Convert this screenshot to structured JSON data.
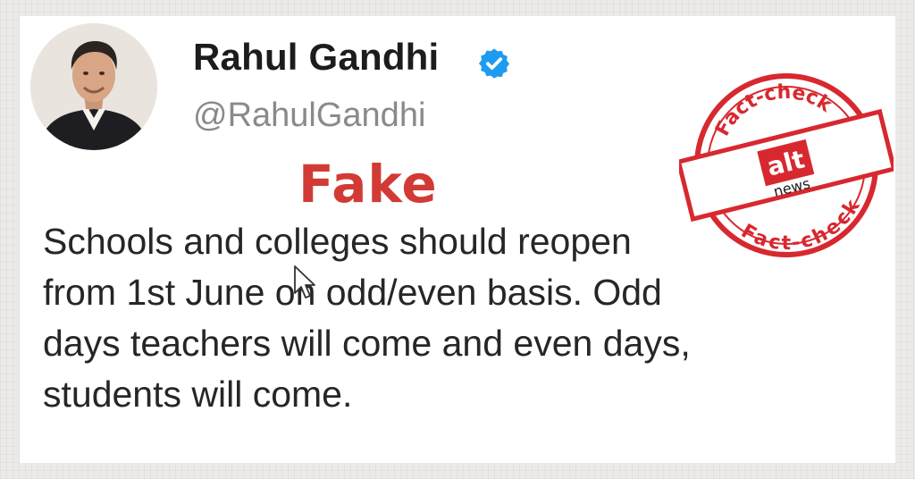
{
  "tweet": {
    "author_name": "Rahul Gandhi",
    "handle": "@RahulGandhi",
    "verdict_label": "Fake",
    "lines": [
      "Schools and colleges should reopen",
      "from 1st June on odd/even basis. Odd",
      "days teachers will come and even days,",
      "students will come."
    ]
  },
  "stamp": {
    "top_text": "Fact-check",
    "bottom_text": "Fact-check",
    "logo_text": "alt",
    "logo_subtext": "news"
  },
  "icons": {
    "verified": "verified-badge-icon",
    "cursor": "mouse-pointer-icon"
  },
  "colors": {
    "verdict": "#d23b35",
    "stamp_red": "#d8282f",
    "verified_blue": "#1d9bf0",
    "text": "#262626",
    "handle": "#8a8a8a"
  }
}
